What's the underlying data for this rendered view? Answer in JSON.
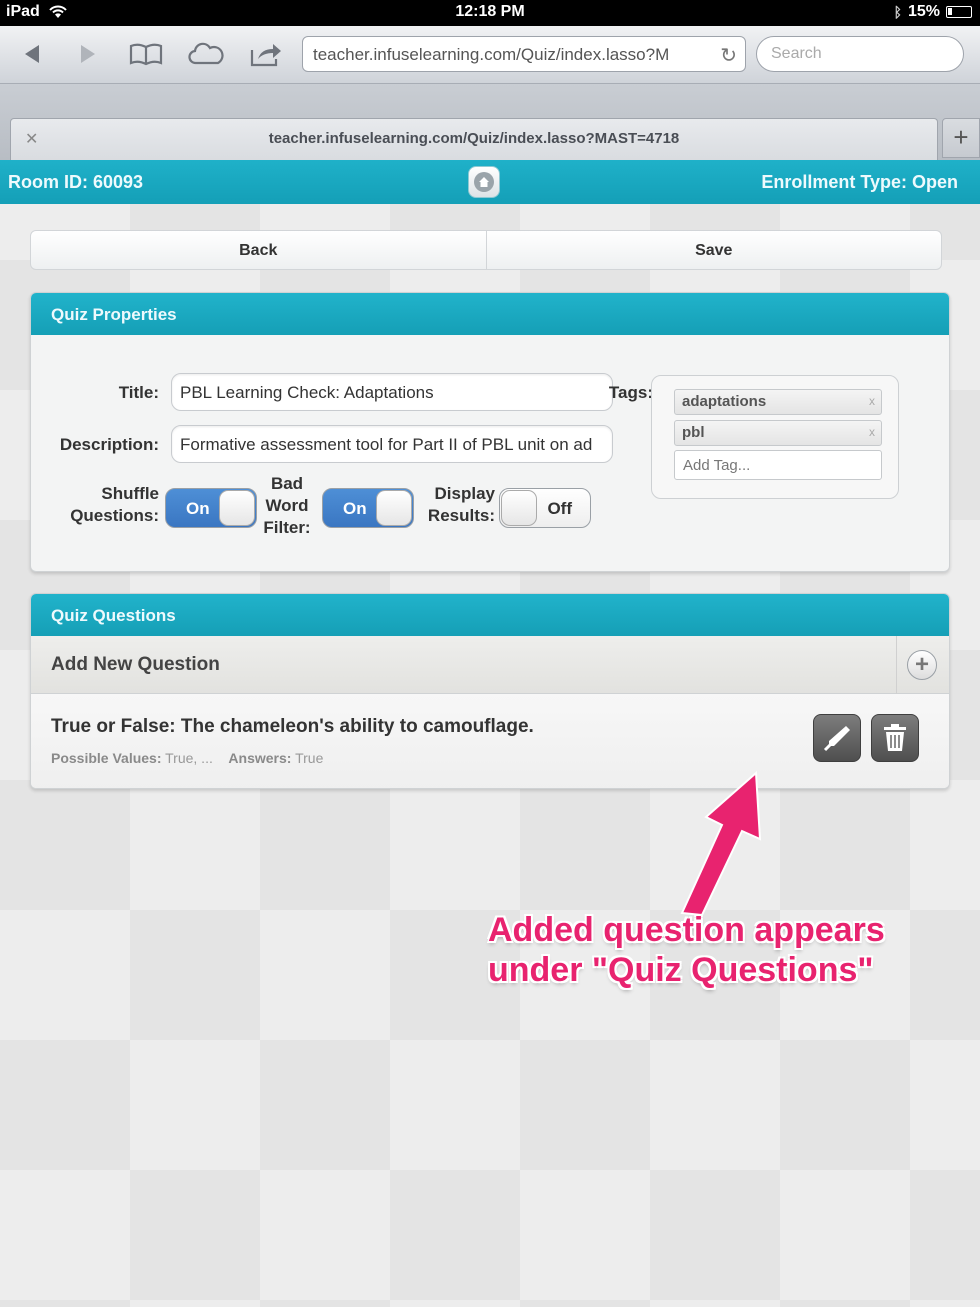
{
  "status_bar": {
    "device": "iPad",
    "time": "12:18 PM",
    "battery": "15%"
  },
  "browser": {
    "url": "teacher.infuselearning.com/Quiz/index.lasso?M",
    "search_placeholder": "Search",
    "tab_title": "teacher.infuselearning.com/Quiz/index.lasso?MAST=4718"
  },
  "header": {
    "room_id": "Room ID: 60093",
    "enrollment": "Enrollment Type: Open"
  },
  "actions": {
    "back": "Back",
    "save": "Save"
  },
  "quiz_properties": {
    "heading": "Quiz Properties",
    "title_label": "Title:",
    "title_value": "PBL Learning Check: Adaptations",
    "description_label": "Description:",
    "description_value": "Formative assessment tool for Part II of PBL unit on ad",
    "shuffle_label": "Shuffle Questions:",
    "shuffle_state": "On",
    "bad_word_label": "Bad Word Filter:",
    "bad_word_state": "On",
    "display_results_label": "Display Results:",
    "display_results_state": "Off",
    "tags_label": "Tags:",
    "tags": [
      "adaptations",
      "pbl"
    ],
    "add_tag_placeholder": "Add Tag..."
  },
  "quiz_questions": {
    "heading": "Quiz Questions",
    "add_new": "Add New Question",
    "items": [
      {
        "question": "True or False: The chameleon's ability to camouflage.",
        "possible_values_label": "Possible Values:",
        "possible_values": "True, ...",
        "answers_label": "Answers:",
        "answers": "True"
      }
    ]
  },
  "annotation": {
    "line1": "Added question appears",
    "line2": "under \"Quiz Questions\"",
    "color": "#e8236f"
  },
  "icons": [
    "back-arrow-icon",
    "forward-arrow-icon",
    "bookmarks-icon",
    "cloud-icon",
    "share-icon",
    "reload-icon",
    "home-icon",
    "plus-icon",
    "edit-icon",
    "trash-icon"
  ]
}
